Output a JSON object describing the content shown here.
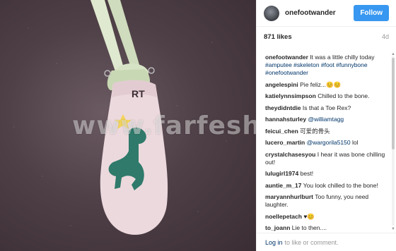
{
  "header": {
    "username": "onefootwander",
    "follow_label": "Follow"
  },
  "meta": {
    "likes": "871 likes",
    "age": "4d"
  },
  "photo": {
    "watermark": "www.farfesh.com",
    "sock_text": "RT"
  },
  "caption": {
    "user": "onefootwander",
    "text": "It was a little chilly today",
    "tags": "#amputee #skeleton #foot #funnybone #onefootwander"
  },
  "comments": [
    {
      "user": "angelespini",
      "text": "Pie feliz...😊😊"
    },
    {
      "user": "katielynnsimpson",
      "text": "Chilled to the bone."
    },
    {
      "user": "theydidntdie",
      "text": "Is that a Toe Rex?"
    },
    {
      "user": "hannahsturley",
      "mention": "@williamtagg",
      "text": ""
    },
    {
      "user": "feicui_chen",
      "text": "可爱的骨头"
    },
    {
      "user": "lucero_martin",
      "mention": "@wargorila5150",
      "text": "lol"
    },
    {
      "user": "crystalchasesyou",
      "text": "I hear it was bone chilling out!"
    },
    {
      "user": "lulugirl1974",
      "text": "best!"
    },
    {
      "user": "auntie_m_17",
      "text": "You look chilled to the bone!"
    },
    {
      "user": "maryannhurlburt",
      "text": "Too funny, you need laughter."
    },
    {
      "user": "noellepetach",
      "text": "♥😊"
    },
    {
      "user": "to_joann",
      "text": "Lie to then...."
    }
  ],
  "footer": {
    "login_label": "Log in",
    "rest": "to like or comment."
  },
  "icons": {
    "scroll_up": "arrow-up-icon",
    "scroll_down": "arrow-down-icon"
  },
  "colors": {
    "accent": "#3897f0",
    "link": "#003569",
    "dino": "#2f7a6a"
  }
}
